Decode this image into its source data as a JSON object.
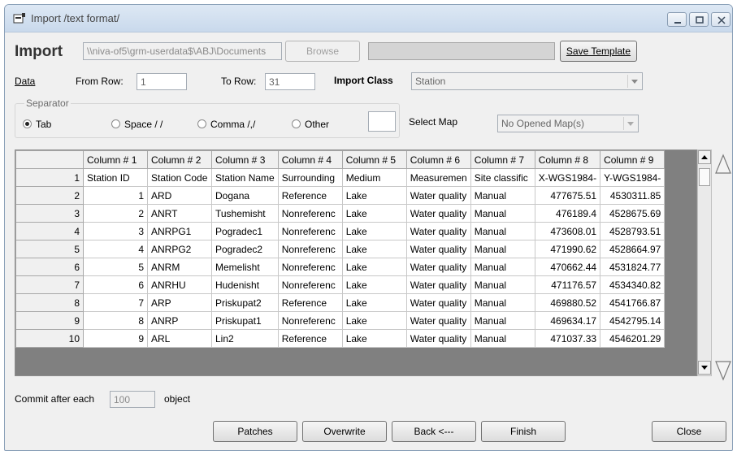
{
  "window": {
    "title": "Import /text format/"
  },
  "header": {
    "title": "Import",
    "path_value": "\\\\niva-of5\\grm-userdata$\\ABJ\\Documents",
    "browse_label": "Browse",
    "save_template_label": "Save Template"
  },
  "params": {
    "data_label": "Data",
    "from_row_label": "From Row:",
    "from_row_value": "1",
    "to_row_label": "To Row:",
    "to_row_value": "31",
    "import_class_label": "Import Class",
    "import_class_value": "Station"
  },
  "separator": {
    "caption": "Separator",
    "options": [
      "Tab",
      "Space / /",
      "Comma /,/",
      "Other"
    ],
    "selected": "Tab",
    "other_value": "",
    "select_map_label": "Select Map",
    "select_map_value": "No Opened Map(s)"
  },
  "grid": {
    "columns": [
      "Column # 1",
      "Column # 2",
      "Column # 3",
      "Column # 4",
      "Column # 5",
      "Column # 6",
      "Column # 7",
      "Column # 8",
      "Column # 9"
    ],
    "rows": [
      {
        "n": "1",
        "c": [
          "Station ID",
          "Station Code",
          "Station Name",
          "Surrounding",
          "Medium",
          "Measuremen",
          "Site classific",
          "X-WGS1984-",
          "Y-WGS1984-"
        ]
      },
      {
        "n": "2",
        "c": [
          "1",
          "ARD",
          "Dogana",
          "Reference",
          "Lake",
          "Water quality",
          "Manual",
          "477675.51",
          "4530311.85"
        ]
      },
      {
        "n": "3",
        "c": [
          "2",
          "ANRT",
          "Tushemisht",
          "Nonreferenc",
          "Lake",
          "Water quality",
          "Manual",
          "476189.4",
          "4528675.69"
        ]
      },
      {
        "n": "4",
        "c": [
          "3",
          "ANRPG1",
          "Pogradec1",
          "Nonreferenc",
          "Lake",
          "Water quality",
          "Manual",
          "473608.01",
          "4528793.51"
        ]
      },
      {
        "n": "5",
        "c": [
          "4",
          "ANRPG2",
          "Pogradec2",
          "Nonreferenc",
          "Lake",
          "Water quality",
          "Manual",
          "471990.62",
          "4528664.97"
        ]
      },
      {
        "n": "6",
        "c": [
          "5",
          "ANRM",
          "Memelisht",
          "Nonreferenc",
          "Lake",
          "Water quality",
          "Manual",
          "470662.44",
          "4531824.77"
        ]
      },
      {
        "n": "7",
        "c": [
          "6",
          "ANRHU",
          "Hudenisht",
          "Nonreferenc",
          "Lake",
          "Water quality",
          "Manual",
          "471176.57",
          "4534340.82"
        ]
      },
      {
        "n": "8",
        "c": [
          "7",
          "ARP",
          "Priskupat2",
          "Reference",
          "Lake",
          "Water quality",
          "Manual",
          "469880.52",
          "4541766.87"
        ]
      },
      {
        "n": "9",
        "c": [
          "8",
          "ANRP",
          "Priskupat1",
          "Nonreferenc",
          "Lake",
          "Water quality",
          "Manual",
          "469634.17",
          "4542795.14"
        ]
      },
      {
        "n": "10",
        "c": [
          "9",
          "ARL",
          "Lin2",
          "Reference",
          "Lake",
          "Water quality",
          "Manual",
          "471037.33",
          "4546201.29"
        ]
      }
    ]
  },
  "footer": {
    "commit_label": "Commit after each",
    "commit_value": "100",
    "object_label": "object",
    "buttons": {
      "patches": "Patches",
      "overwrite": "Overwrite",
      "back": "Back <---",
      "finish": "Finish",
      "close": "Close"
    }
  }
}
